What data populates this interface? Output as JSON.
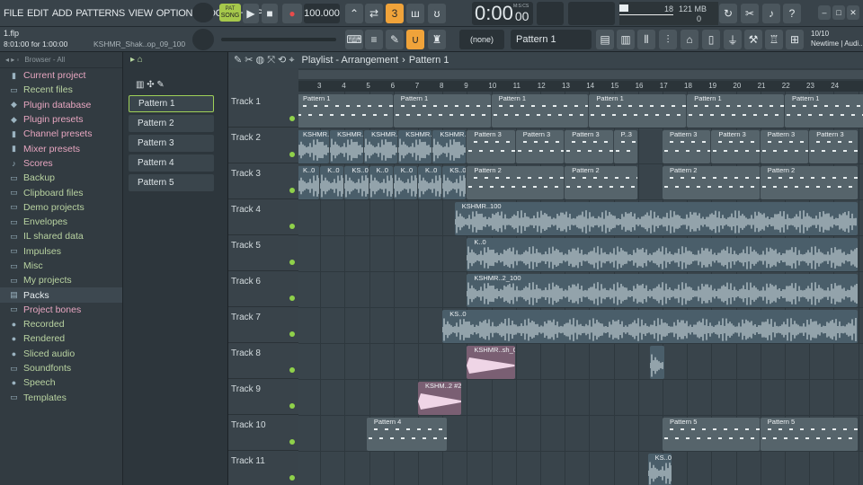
{
  "menu": [
    "FILE",
    "EDIT",
    "ADD",
    "PATTERNS",
    "VIEW",
    "OPTIONS",
    "TOOLS",
    "HELP"
  ],
  "transport": {
    "mode_top": "PAT",
    "mode_label": "SONG",
    "tempo": "100.000",
    "time": "0:00",
    "time_sub": "00",
    "time_unit": "M:S:CS",
    "cpu": "18",
    "memory": "121 MB",
    "voices": "0"
  },
  "project": {
    "file": "1.flp",
    "time_hint": "8:01:00 for 1:00:00",
    "sample": "KSHMR_Shak..op_09_100"
  },
  "snap": "(none)",
  "current_pattern": "Pattern 1",
  "news": {
    "count": "10/10",
    "title": "Newtime | Audi.."
  },
  "browser": {
    "header": "Browser - All",
    "items": [
      {
        "label": "Current project",
        "color": "pink",
        "icon": "project-icon"
      },
      {
        "label": "Recent files",
        "color": "green",
        "icon": "folder-icon"
      },
      {
        "label": "Plugin database",
        "color": "pink",
        "icon": "plug-icon"
      },
      {
        "label": "Plugin presets",
        "color": "pink",
        "icon": "plug-icon"
      },
      {
        "label": "Channel presets",
        "color": "pink",
        "icon": "channel-icon"
      },
      {
        "label": "Mixer presets",
        "color": "pink",
        "icon": "mixer-icon"
      },
      {
        "label": "Scores",
        "color": "pink",
        "icon": "note-icon"
      },
      {
        "label": "Backup",
        "color": "green",
        "icon": "folder-icon"
      },
      {
        "label": "Clipboard files",
        "color": "green",
        "icon": "folder-icon"
      },
      {
        "label": "Demo projects",
        "color": "green",
        "icon": "folder-icon"
      },
      {
        "label": "Envelopes",
        "color": "green",
        "icon": "folder-icon"
      },
      {
        "label": "IL shared data",
        "color": "green",
        "icon": "folder-icon"
      },
      {
        "label": "Impulses",
        "color": "green",
        "icon": "folder-icon"
      },
      {
        "label": "Misc",
        "color": "green",
        "icon": "folder-icon"
      },
      {
        "label": "My projects",
        "color": "green",
        "icon": "folder-icon"
      },
      {
        "label": "Packs",
        "color": "green",
        "icon": "pack-icon"
      },
      {
        "label": "Project bones",
        "color": "pink",
        "icon": "bones-icon"
      },
      {
        "label": "Recorded",
        "color": "green",
        "icon": "record-icon"
      },
      {
        "label": "Rendered",
        "color": "green",
        "icon": "render-icon"
      },
      {
        "label": "Sliced audio",
        "color": "green",
        "icon": "slice-icon"
      },
      {
        "label": "Soundfonts",
        "color": "green",
        "icon": "folder-icon"
      },
      {
        "label": "Speech",
        "color": "green",
        "icon": "speech-icon"
      },
      {
        "label": "Templates",
        "color": "green",
        "icon": "folder-icon"
      }
    ]
  },
  "patterns": [
    "Pattern 1",
    "Pattern 2",
    "Pattern 3",
    "Pattern 4",
    "Pattern 5"
  ],
  "playlist": {
    "title": "Playlist - Arrangement",
    "pattern": "Pattern 1",
    "ruler": [
      "3",
      "4",
      "5",
      "6",
      "7",
      "8",
      "9",
      "10",
      "11",
      "12",
      "13",
      "14",
      "15",
      "16",
      "17",
      "18",
      "19",
      "20",
      "21",
      "22",
      "23",
      "24"
    ],
    "tracks": [
      "Track 1",
      "Track 2",
      "Track 3",
      "Track 4",
      "Track 5",
      "Track 6",
      "Track 7",
      "Track 8",
      "Track 9",
      "Track 10",
      "Track 11"
    ],
    "clips": [
      {
        "track": 0,
        "start": 0,
        "len": 4,
        "label": "Pattern 1",
        "kind": "pat"
      },
      {
        "track": 0,
        "start": 4,
        "len": 4,
        "label": "Pattern 1",
        "kind": "pat"
      },
      {
        "track": 0,
        "start": 8,
        "len": 4,
        "label": "Pattern 1",
        "kind": "pat"
      },
      {
        "track": 0,
        "start": 12,
        "len": 4,
        "label": "Pattern 1",
        "kind": "pat"
      },
      {
        "track": 0,
        "start": 16,
        "len": 4,
        "label": "Pattern 1",
        "kind": "pat"
      },
      {
        "track": 0,
        "start": 20,
        "len": 4,
        "label": "Pattern 1",
        "kind": "pat"
      },
      {
        "track": 1,
        "start": 0,
        "len": 1.4,
        "label": "KSHMR..2_100",
        "kind": "wave"
      },
      {
        "track": 1,
        "start": 1.4,
        "len": 1.4,
        "label": "KSHMR..2_100",
        "kind": "wave"
      },
      {
        "track": 1,
        "start": 2.8,
        "len": 1.4,
        "label": "KSHMR..2_100",
        "kind": "wave"
      },
      {
        "track": 1,
        "start": 4.2,
        "len": 1.4,
        "label": "KSHMR..2_100",
        "kind": "wave"
      },
      {
        "track": 1,
        "start": 5.6,
        "len": 1.4,
        "label": "KSHMR..2_100",
        "kind": "wave"
      },
      {
        "track": 1,
        "start": 7,
        "len": 2,
        "label": "Pattern 3",
        "kind": "pat"
      },
      {
        "track": 1,
        "start": 9,
        "len": 2,
        "label": "Pattern 3",
        "kind": "pat"
      },
      {
        "track": 1,
        "start": 11,
        "len": 2,
        "label": "Pattern 3",
        "kind": "pat"
      },
      {
        "track": 1,
        "start": 13,
        "len": 1,
        "label": "P..3",
        "kind": "pat"
      },
      {
        "track": 1,
        "start": 15,
        "len": 2,
        "label": "Pattern 3",
        "kind": "pat"
      },
      {
        "track": 1,
        "start": 17,
        "len": 2,
        "label": "Pattern 3",
        "kind": "pat"
      },
      {
        "track": 1,
        "start": 19,
        "len": 2,
        "label": "Pattern 3",
        "kind": "pat"
      },
      {
        "track": 1,
        "start": 21,
        "len": 2,
        "label": "Pattern 3",
        "kind": "pat"
      },
      {
        "track": 2,
        "start": 0,
        "len": 1,
        "label": "K..0",
        "kind": "wave"
      },
      {
        "track": 2,
        "start": 1,
        "len": 1,
        "label": "K..0",
        "kind": "wave"
      },
      {
        "track": 2,
        "start": 2,
        "len": 1,
        "label": "KS..0",
        "kind": "wave"
      },
      {
        "track": 2,
        "start": 3,
        "len": 1,
        "label": "K..0",
        "kind": "wave"
      },
      {
        "track": 2,
        "start": 4,
        "len": 1,
        "label": "K..0",
        "kind": "wave"
      },
      {
        "track": 2,
        "start": 5,
        "len": 1,
        "label": "K..0",
        "kind": "wave"
      },
      {
        "track": 2,
        "start": 6,
        "len": 1,
        "label": "KS..0",
        "kind": "wave"
      },
      {
        "track": 2,
        "start": 7,
        "len": 4,
        "label": "Pattern 2",
        "kind": "pat"
      },
      {
        "track": 2,
        "start": 11,
        "len": 3,
        "label": "Pattern 2",
        "kind": "pat"
      },
      {
        "track": 2,
        "start": 15,
        "len": 4,
        "label": "Pattern 2",
        "kind": "pat"
      },
      {
        "track": 2,
        "start": 19,
        "len": 4,
        "label": "Pattern 2",
        "kind": "pat"
      },
      {
        "track": 3,
        "start": 6.5,
        "len": 16.5,
        "label": "KSHMR..100",
        "kind": "wave"
      },
      {
        "track": 4,
        "start": 7,
        "len": 16,
        "label": "K..0",
        "kind": "wave"
      },
      {
        "track": 5,
        "start": 7,
        "len": 16,
        "label": "KSHMR..2_100",
        "kind": "wave"
      },
      {
        "track": 6,
        "start": 6,
        "len": 17,
        "label": "KS..0",
        "kind": "wave"
      },
      {
        "track": 7,
        "start": 7,
        "len": 2,
        "label": "KSHMR..sh_02",
        "kind": "pink"
      },
      {
        "track": 7,
        "start": 14.5,
        "len": 0.6,
        "label": "",
        "kind": "wave"
      },
      {
        "track": 8,
        "start": 5,
        "len": 1.8,
        "label": "KSHM..2 #2",
        "kind": "pink"
      },
      {
        "track": 9,
        "start": 2.9,
        "len": 3.3,
        "label": "Pattern 4",
        "kind": "pat"
      },
      {
        "track": 9,
        "start": 15,
        "len": 4,
        "label": "Pattern 5",
        "kind": "pat"
      },
      {
        "track": 9,
        "start": 19,
        "len": 4,
        "label": "Pattern 5",
        "kind": "pat"
      },
      {
        "track": 10,
        "start": 14.4,
        "len": 1,
        "label": "KS..0",
        "kind": "wave"
      }
    ]
  }
}
